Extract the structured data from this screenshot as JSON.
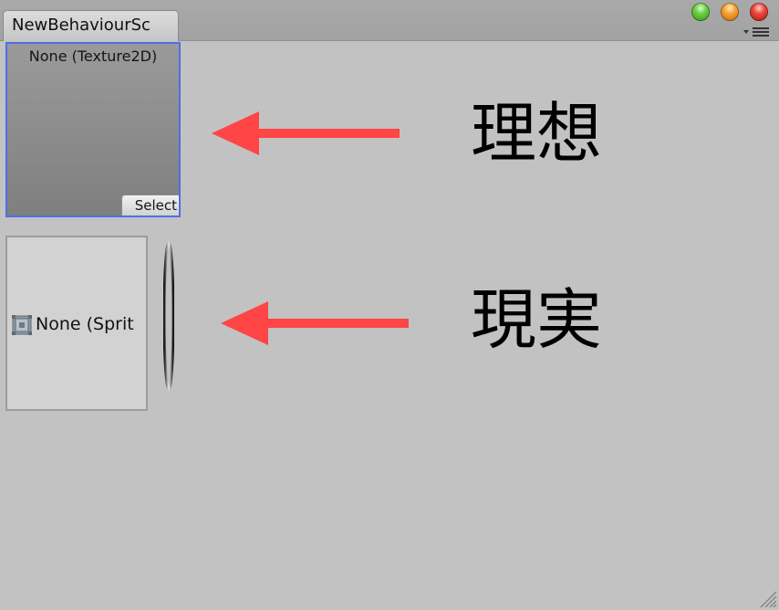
{
  "window": {
    "tab_title": "NewBehaviourSc"
  },
  "texture_field": {
    "value": "None (Texture2D)",
    "select_label": "Select"
  },
  "sprite_field": {
    "value": "None (Sprit"
  },
  "annotations": {
    "ideal": "理想",
    "reality": "現実"
  },
  "icons": {
    "window_buttons": [
      "green-zoom-icon",
      "orange-minimize-icon",
      "red-close-icon"
    ],
    "panel_menu": "panel-menu-icon",
    "sprite": "sprite-icon",
    "resize": "resize-grip-icon"
  },
  "colors": {
    "arrow": "#ff4545",
    "selection_border": "#4f6fe6",
    "background": "#c2c2c2"
  }
}
